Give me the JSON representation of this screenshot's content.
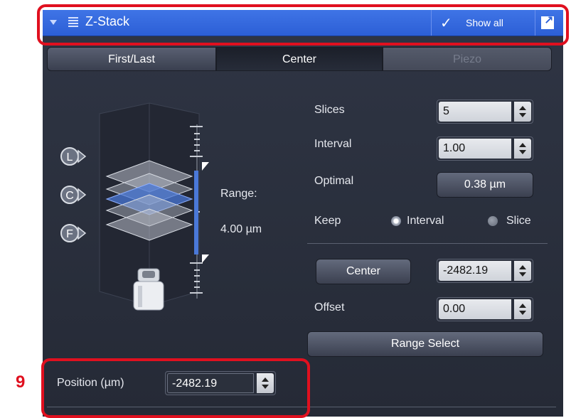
{
  "header": {
    "title": "Z-Stack",
    "show_all_label": "Show all",
    "check_glyph": "✓"
  },
  "tabs": [
    {
      "label": "First/Last"
    },
    {
      "label": "Center"
    },
    {
      "label": "Piezo"
    }
  ],
  "diagram": {
    "markers": [
      "L",
      "C",
      "F"
    ],
    "range_label": "Range:",
    "range_value": "4.00 µm"
  },
  "settings": {
    "slices_label": "Slices",
    "slices_value": "5",
    "interval_label": "Interval",
    "interval_value": "1.00",
    "optimal_label": "Optimal",
    "optimal_value": "0.38 µm",
    "keep_label": "Keep",
    "keep_options": [
      {
        "label": "Interval",
        "selected": true
      },
      {
        "label": "Slice",
        "selected": false
      }
    ],
    "center_button": "Center",
    "center_value": "-2482.19",
    "offset_label": "Offset",
    "offset_value": "0.00",
    "range_select_button": "Range Select"
  },
  "position": {
    "label": "Position (µm)",
    "value": "-2482.19"
  },
  "annotation": {
    "step_number": "9"
  },
  "colors": {
    "title_bar": "#3f74e6",
    "panel": "#2f3544",
    "highlight_frame": "#e0101f",
    "range_bar": "#4a78d8"
  }
}
